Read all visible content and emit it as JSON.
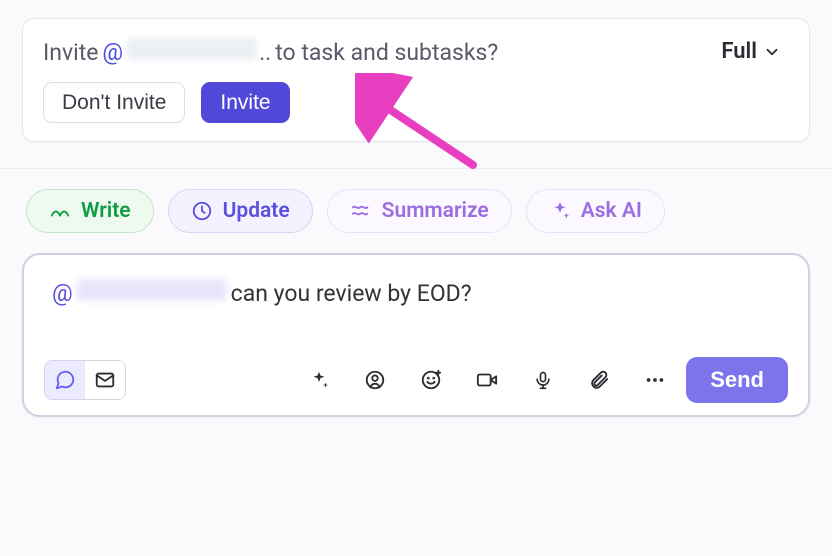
{
  "invite": {
    "prefix": "Invite ",
    "at": "@",
    "ellipsis": "..",
    "suffix": " to task and subtasks?",
    "scope_label": "Full",
    "dont_invite_label": "Don't Invite",
    "invite_label": "Invite"
  },
  "pills": {
    "write": "Write",
    "update": "Update",
    "summarize": "Summarize",
    "ask_ai": "Ask AI"
  },
  "composer": {
    "at": "@",
    "text_rest": " can you review by EOD?",
    "send_label": "Send"
  },
  "colors": {
    "primary": "#4f48d8",
    "accent_arrow": "#e83fc0",
    "pill_green": "#0f9d43",
    "pill_purple": "#5b4fe0",
    "pill_light_purple": "#9c6de0",
    "send": "#7d74ec"
  }
}
